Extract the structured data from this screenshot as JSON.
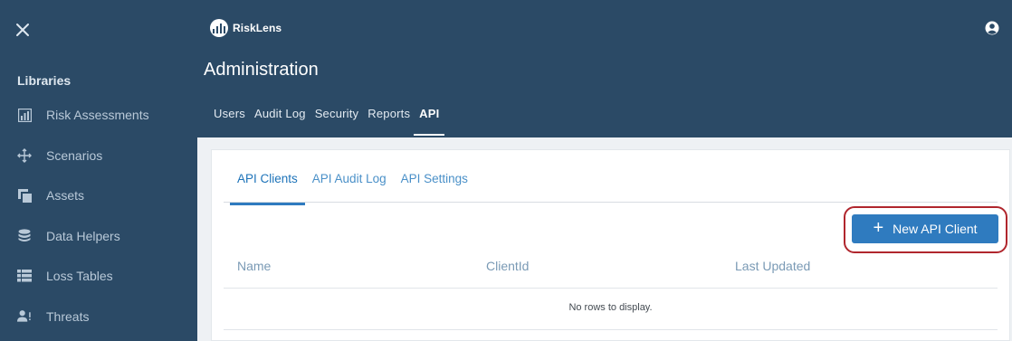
{
  "brand": {
    "name": "RiskLens"
  },
  "colors": {
    "navy": "#2b4a66",
    "accent_blue": "#2f7bbf",
    "highlight_red": "#b0262d"
  },
  "sidebar": {
    "close_icon": "close-icon",
    "section_label": "Libraries",
    "items": [
      {
        "label": "Risk Assessments",
        "icon": "chart-icon"
      },
      {
        "label": "Scenarios",
        "icon": "scenarios-icon"
      },
      {
        "label": "Assets",
        "icon": "assets-icon"
      },
      {
        "label": "Data Helpers",
        "icon": "database-icon"
      },
      {
        "label": "Loss Tables",
        "icon": "table-icon"
      },
      {
        "label": "Threats",
        "icon": "threats-icon"
      }
    ]
  },
  "header": {
    "title": "Administration",
    "tabs": [
      {
        "label": "Users",
        "active": false
      },
      {
        "label": "Audit Log",
        "active": false
      },
      {
        "label": "Security",
        "active": false
      },
      {
        "label": "Reports",
        "active": false
      },
      {
        "label": "API",
        "active": true
      }
    ]
  },
  "api": {
    "tabs": [
      {
        "label": "API Clients",
        "active": true
      },
      {
        "label": "API Audit Log",
        "active": false
      },
      {
        "label": "API Settings",
        "active": false
      }
    ],
    "new_button_label": "New API Client",
    "table": {
      "columns": [
        "Name",
        "ClientId",
        "Last Updated"
      ],
      "empty_message": "No rows to display."
    }
  }
}
